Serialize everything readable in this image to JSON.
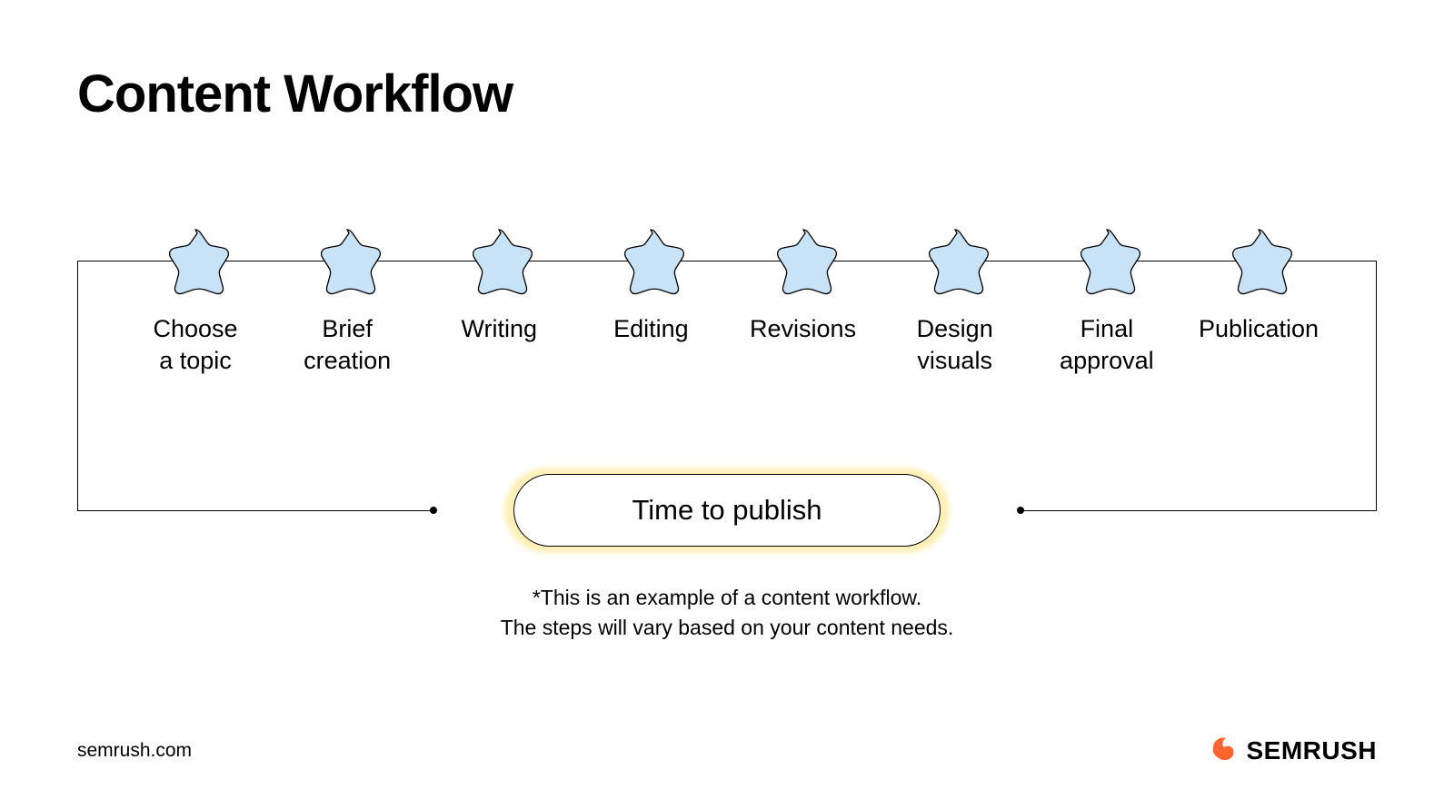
{
  "title": "Content Workflow",
  "steps": [
    {
      "label": "Choose\na topic"
    },
    {
      "label": "Brief\ncreation"
    },
    {
      "label": "Writing"
    },
    {
      "label": "Editing"
    },
    {
      "label": "Revisions"
    },
    {
      "label": "Design\nvisuals"
    },
    {
      "label": "Final\napproval"
    },
    {
      "label": "Publication"
    }
  ],
  "publish_label": "Time to publish",
  "footnote_line1": "*This is an example of a content workflow.",
  "footnote_line2": "The steps will vary based on your content needs.",
  "footer_url": "semrush.com",
  "logo_text": "SEMRUSH",
  "colors": {
    "star_fill": "#c8e2f7",
    "star_stroke": "#000",
    "glow": "#fff0b8",
    "logo_orange": "#ff642d"
  }
}
